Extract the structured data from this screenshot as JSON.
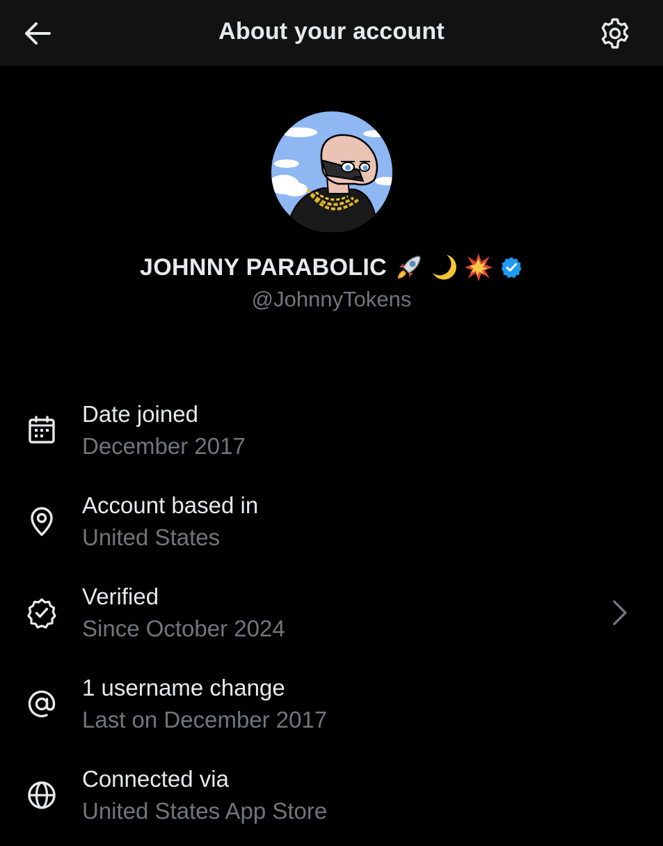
{
  "header": {
    "title": "About your account",
    "back_icon": "arrow-left-icon",
    "settings_icon": "gear-icon"
  },
  "profile": {
    "display_name": "JOHNNY PARABOLIC",
    "name_emojis": [
      "rocket",
      "crescent-moon",
      "collision"
    ],
    "verified_badge_color": "#1d9bf0",
    "handle": "@JohnnyTokens",
    "avatar": "cartoon-character-avatar"
  },
  "details": [
    {
      "icon": "calendar-icon",
      "title": "Date joined",
      "subtitle": "December 2017",
      "has_chevron": false
    },
    {
      "icon": "location-pin-icon",
      "title": "Account based in",
      "subtitle": "United States",
      "has_chevron": false
    },
    {
      "icon": "verified-badge-icon",
      "title": "Verified",
      "subtitle": "Since October 2024",
      "has_chevron": true
    },
    {
      "icon": "at-sign-icon",
      "title": "1 username change",
      "subtitle": "Last on December 2017",
      "has_chevron": false
    },
    {
      "icon": "globe-icon",
      "title": "Connected via",
      "subtitle": "United States App Store",
      "has_chevron": false
    }
  ],
  "colors": {
    "background": "#000000",
    "header_background": "#121212",
    "primary_text": "#e7e9ea",
    "secondary_text": "#71767b",
    "accent": "#1d9bf0"
  }
}
